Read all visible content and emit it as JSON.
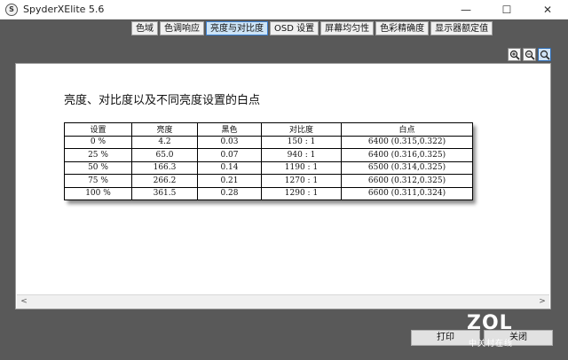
{
  "window": {
    "title": "SpyderXElite 5.6",
    "icon_letter": "S"
  },
  "window_controls": {
    "minimize": "—",
    "maximize": "☐",
    "close": "✕"
  },
  "tabs": [
    {
      "label": "色域",
      "active": false
    },
    {
      "label": "色调响应",
      "active": false
    },
    {
      "label": "亮度与对比度",
      "active": true
    },
    {
      "label": "OSD 设置",
      "active": false
    },
    {
      "label": "屏幕均匀性",
      "active": false
    },
    {
      "label": "色彩精确度",
      "active": false
    },
    {
      "label": "显示器额定值",
      "active": false
    }
  ],
  "zoom_tools": [
    "zoom-in-icon",
    "zoom-out-icon",
    "zoom-fit-icon"
  ],
  "report": {
    "title": "亮度、对比度以及不同亮度设置的白点",
    "table": {
      "headers": [
        "设置",
        "亮度",
        "黑色",
        "对比度",
        "白点"
      ],
      "rows": [
        [
          "0 %",
          "4.2",
          "0.03",
          "150 : 1",
          "6400 (0.315,0.322)"
        ],
        [
          "25 %",
          "65.0",
          "0.07",
          "940 : 1",
          "6400 (0.316,0.325)"
        ],
        [
          "50 %",
          "166.3",
          "0.14",
          "1190 : 1",
          "6500 (0.314,0.325)"
        ],
        [
          "75 %",
          "266.2",
          "0.21",
          "1270 : 1",
          "6600 (0.312,0.325)"
        ],
        [
          "100 %",
          "361.5",
          "0.28",
          "1290 : 1",
          "6600 (0.311,0.324)"
        ]
      ]
    }
  },
  "scrollbar": {
    "left_arrow": "<",
    "right_arrow": ">"
  },
  "buttons": {
    "print": "打印",
    "close": "关闭"
  },
  "watermark": {
    "logo": "ZOL",
    "sub": "中关村在线"
  }
}
